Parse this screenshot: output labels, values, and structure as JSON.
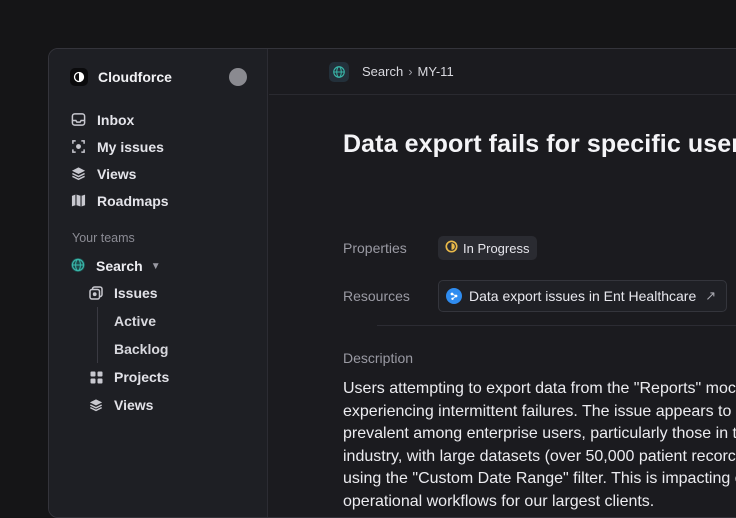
{
  "workspace": {
    "name": "Cloudforce"
  },
  "nav": [
    {
      "label": "Inbox",
      "icon": "inbox-icon"
    },
    {
      "label": "My issues",
      "icon": "target-icon"
    },
    {
      "label": "Views",
      "icon": "layers-icon"
    },
    {
      "label": "Roadmaps",
      "icon": "map-icon"
    }
  ],
  "teams": {
    "section_label": "Your teams",
    "team_name": "Search",
    "items": {
      "issues": "Issues",
      "active": "Active",
      "backlog": "Backlog",
      "projects": "Projects",
      "views": "Views"
    }
  },
  "breadcrumb": {
    "team": "Search",
    "issue_id": "MY-11"
  },
  "issue": {
    "title": "Data export fails for specific user g",
    "properties_label": "Properties",
    "status": "In Progress",
    "resources_label": "Resources",
    "resource_link": "Data export issues in Ent Healthcare",
    "description_label": "Description",
    "description_lines": [
      "Users attempting to export data from the \"Reports\" moc",
      "experiencing intermittent failures. The issue appears to",
      "prevalent among enterprise users, particularly those in t",
      "industry, with large datasets (over 50,000 patient recorc",
      "using the \"Custom Date Range\" filter. This is impacting c",
      "operational workflows for our largest clients."
    ]
  },
  "colors": {
    "status_in_progress": "#e9b949",
    "resource_blue": "#2f8cf0",
    "team_globe": "#39b5a8"
  }
}
